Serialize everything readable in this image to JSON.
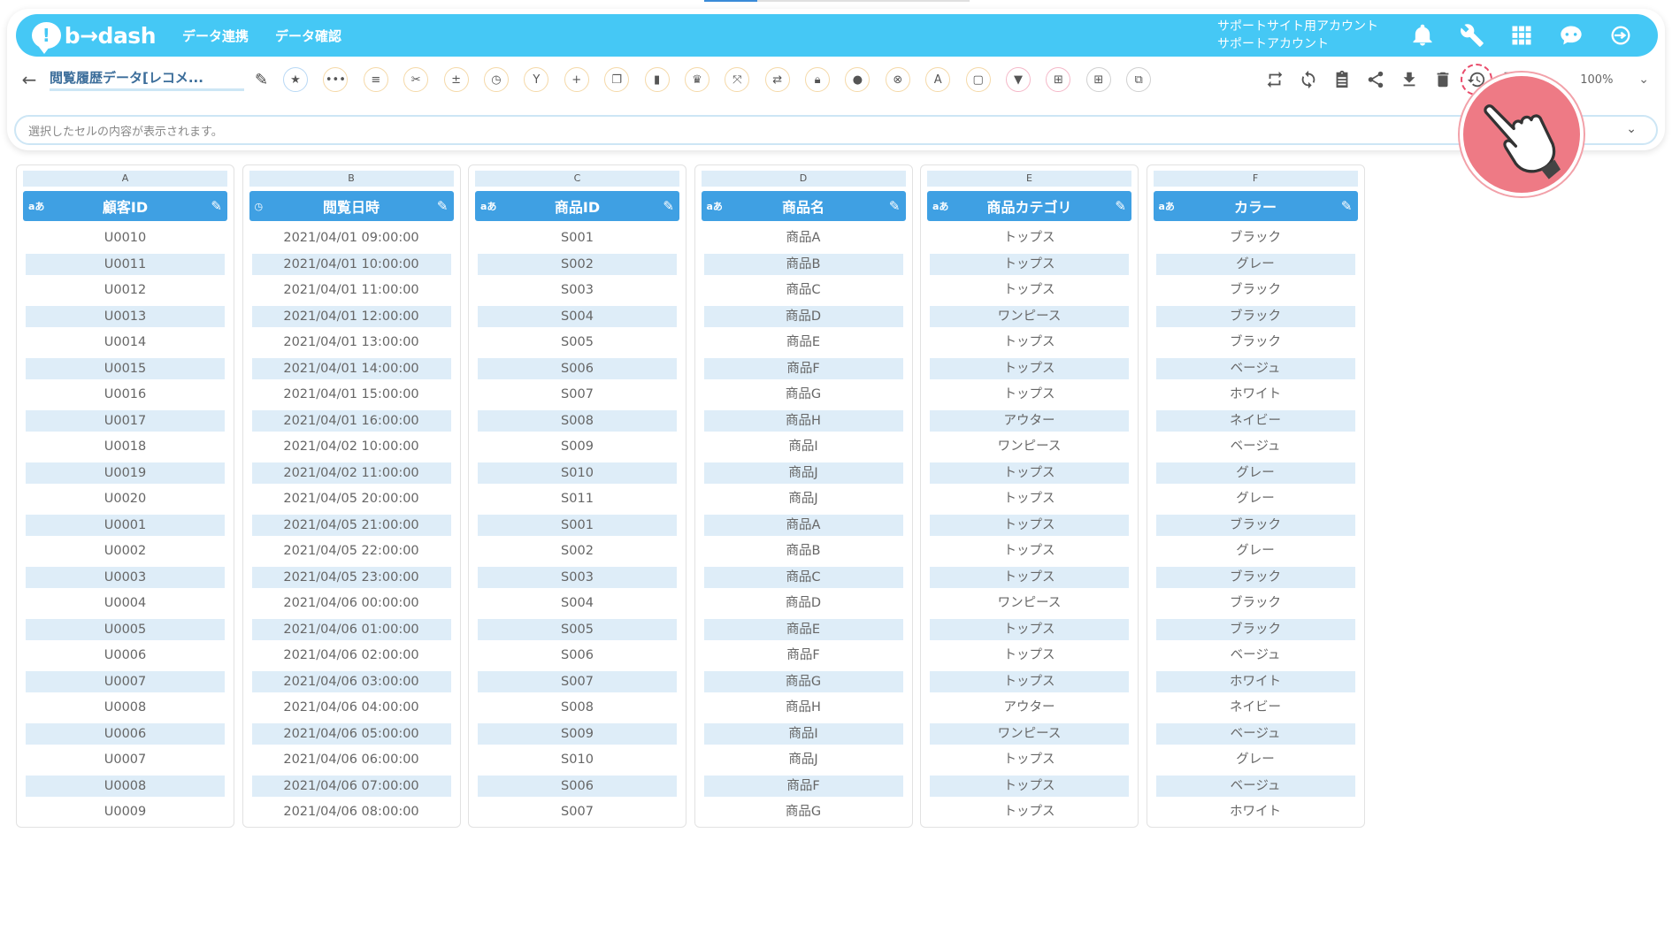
{
  "header": {
    "logo_mark": "!",
    "logo_text": "b→dash",
    "nav": [
      "データ連携",
      "データ確認"
    ],
    "account_line1": "サポートサイト用アカウント",
    "account_line2": "サポートアカウント",
    "icons": [
      "bell-icon",
      "wrench-icon",
      "apps-grid-icon",
      "chatbot-icon",
      "logout-icon"
    ]
  },
  "toolbar": {
    "back_icon": "←",
    "title": "閲覧履歴データ[レコメ...",
    "edit_icon": "✎",
    "tools": [
      {
        "name": "favorite-icon",
        "glyph": "★",
        "ring": "blue"
      },
      {
        "name": "more-icon",
        "glyph": "•••",
        "ring": "orange"
      },
      {
        "name": "text-icon",
        "glyph": "≡",
        "ring": "orange"
      },
      {
        "name": "tools-icon",
        "glyph": "✂",
        "ring": "orange"
      },
      {
        "name": "calc-icon",
        "glyph": "±",
        "ring": "orange"
      },
      {
        "name": "timer-icon",
        "glyph": "◷",
        "ring": "orange"
      },
      {
        "name": "merge-icon",
        "glyph": "Y",
        "ring": "orange"
      },
      {
        "name": "add-icon",
        "glyph": "+",
        "ring": "orange"
      },
      {
        "name": "copy-icon",
        "glyph": "❐",
        "ring": "orange"
      },
      {
        "name": "delete-column-icon",
        "glyph": "▮",
        "ring": "orange"
      },
      {
        "name": "crown-icon",
        "glyph": "♛",
        "ring": "orange"
      },
      {
        "name": "expand-icon",
        "glyph": "⤧",
        "ring": "orange"
      },
      {
        "name": "convert-icon",
        "glyph": "⇄",
        "ring": "orange"
      },
      {
        "name": "lock-icon",
        "glyph": "🔒︎",
        "ring": "orange"
      },
      {
        "name": "bag-icon",
        "glyph": "●",
        "ring": "orange"
      },
      {
        "name": "exclude-icon",
        "glyph": "⊗",
        "ring": "orange"
      },
      {
        "name": "translate-icon",
        "glyph": "A",
        "ring": "orange"
      },
      {
        "name": "frame-icon",
        "glyph": "▢",
        "ring": "orange"
      },
      {
        "name": "filter-icon",
        "glyph": "▼",
        "ring": "pink"
      },
      {
        "name": "group-icon",
        "glyph": "⊞",
        "ring": "pink"
      },
      {
        "name": "table-icon",
        "glyph": "⊞",
        "ring": "grey"
      },
      {
        "name": "join-icon",
        "glyph": "⧉",
        "ring": "grey"
      }
    ],
    "right_tools": [
      "swap-icon",
      "refresh-icon",
      "clipboard-icon",
      "share-icon",
      "download-icon",
      "trash-icon",
      "history-icon",
      "notebook-icon"
    ],
    "zoom": "100%"
  },
  "formula_bar": {
    "placeholder": "選択したセルの内容が表示されます。"
  },
  "columns": [
    {
      "letter": "A",
      "type": "aあ",
      "name": "顧客ID",
      "cells": [
        "U0010",
        "U0011",
        "U0012",
        "U0013",
        "U0014",
        "U0015",
        "U0016",
        "U0017",
        "U0018",
        "U0019",
        "U0020",
        "U0001",
        "U0002",
        "U0003",
        "U0004",
        "U0005",
        "U0006",
        "U0007",
        "U0008",
        "U0006",
        "U0007",
        "U0008",
        "U0009"
      ]
    },
    {
      "letter": "B",
      "type": "◷",
      "name": "閲覧日時",
      "cells": [
        "2021/04/01 09:00:00",
        "2021/04/01 10:00:00",
        "2021/04/01 11:00:00",
        "2021/04/01 12:00:00",
        "2021/04/01 13:00:00",
        "2021/04/01 14:00:00",
        "2021/04/01 15:00:00",
        "2021/04/01 16:00:00",
        "2021/04/02 10:00:00",
        "2021/04/02 11:00:00",
        "2021/04/05 20:00:00",
        "2021/04/05 21:00:00",
        "2021/04/05 22:00:00",
        "2021/04/05 23:00:00",
        "2021/04/06 00:00:00",
        "2021/04/06 01:00:00",
        "2021/04/06 02:00:00",
        "2021/04/06 03:00:00",
        "2021/04/06 04:00:00",
        "2021/04/06 05:00:00",
        "2021/04/06 06:00:00",
        "2021/04/06 07:00:00",
        "2021/04/06 08:00:00"
      ]
    },
    {
      "letter": "C",
      "type": "aあ",
      "name": "商品ID",
      "cells": [
        "S001",
        "S002",
        "S003",
        "S004",
        "S005",
        "S006",
        "S007",
        "S008",
        "S009",
        "S010",
        "S011",
        "S001",
        "S002",
        "S003",
        "S004",
        "S005",
        "S006",
        "S007",
        "S008",
        "S009",
        "S010",
        "S006",
        "S007"
      ]
    },
    {
      "letter": "D",
      "type": "aあ",
      "name": "商品名",
      "cells": [
        "商品A",
        "商品B",
        "商品C",
        "商品D",
        "商品E",
        "商品F",
        "商品G",
        "商品H",
        "商品I",
        "商品J",
        "商品J",
        "商品A",
        "商品B",
        "商品C",
        "商品D",
        "商品E",
        "商品F",
        "商品G",
        "商品H",
        "商品I",
        "商品J",
        "商品F",
        "商品G"
      ]
    },
    {
      "letter": "E",
      "type": "aあ",
      "name": "商品カテゴリ",
      "cells": [
        "トップス",
        "トップス",
        "トップス",
        "ワンピース",
        "トップス",
        "トップス",
        "トップス",
        "アウター",
        "ワンピース",
        "トップス",
        "トップス",
        "トップス",
        "トップス",
        "トップス",
        "ワンピース",
        "トップス",
        "トップス",
        "トップス",
        "アウター",
        "ワンピース",
        "トップス",
        "トップス",
        "トップス"
      ]
    },
    {
      "letter": "F",
      "type": "aあ",
      "name": "カラー",
      "cells": [
        "ブラック",
        "グレー",
        "ブラック",
        "ブラック",
        "ブラック",
        "ベージュ",
        "ホワイト",
        "ネイビー",
        "ベージュ",
        "グレー",
        "グレー",
        "ブラック",
        "グレー",
        "ブラック",
        "ブラック",
        "ブラック",
        "ベージュ",
        "ホワイト",
        "ネイビー",
        "ベージュ",
        "グレー",
        "ベージュ",
        "ホワイト"
      ]
    }
  ],
  "edit_glyph": "✎",
  "colors": {
    "header_bg": "#45c8f5",
    "column_header_bg": "#3fa0e3",
    "alt_row_bg": "#deedf8",
    "pointer_overlay": "#ee7a85"
  }
}
